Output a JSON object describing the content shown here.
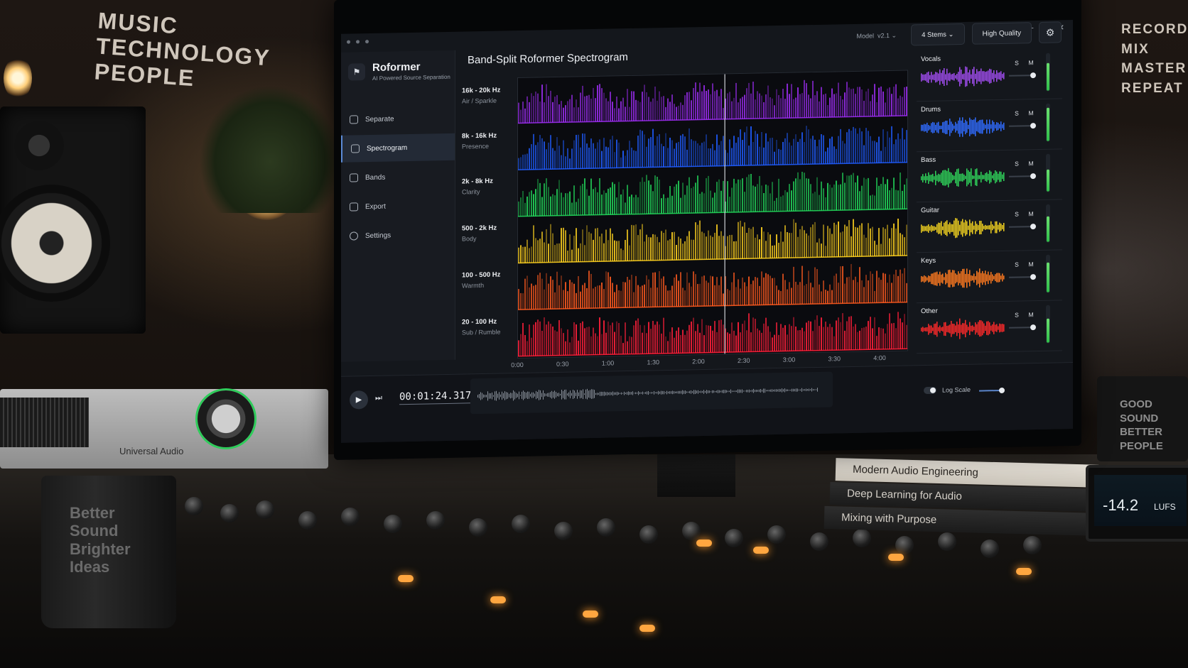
{
  "background": {
    "wall_sign_left": [
      "MUSIC",
      "TECHNOLOGY",
      "PEOPLE"
    ],
    "wall_sign_right": [
      "RECORD",
      "MIX",
      "MASTER",
      "REPEAT"
    ],
    "interface_brand": "Universal Audio",
    "mug_text": [
      "Better",
      "Sound",
      "Brighter",
      "Ideas"
    ],
    "cup_text": [
      "GOOD",
      "SOUND",
      "BETTER",
      "PEOPLE"
    ],
    "books": [
      "Modern Audio Engineering",
      "Deep Learning for Audio",
      "Mixing with Purpose"
    ],
    "loudness_meter": {
      "value": "-14.2",
      "unit": "LUFS"
    }
  },
  "app": {
    "title": "Roformer",
    "subtitle": "AI Powered Source Separation",
    "heading": "Band-Split Roformer Spectrogram",
    "window_controls": [
      "–",
      "▢",
      "✕"
    ],
    "toolbar": {
      "model_label": "Model",
      "model_version": "v2.1",
      "stems_label": "4 Stems",
      "quality_label": "High Quality",
      "gear_icon": "⚙"
    },
    "nav": [
      {
        "label": "Separate",
        "icon": "separate-icon"
      },
      {
        "label": "Spectrogram",
        "icon": "spectrogram-icon",
        "active": true
      },
      {
        "label": "Bands",
        "icon": "bands-icon"
      },
      {
        "label": "Export",
        "icon": "export-icon"
      },
      {
        "label": "Settings",
        "icon": "settings-icon"
      }
    ],
    "bands": [
      {
        "range": "16k - 20k Hz",
        "desc": "Air / Sparkle",
        "color": "#9b2cf0"
      },
      {
        "range": "8k - 16k Hz",
        "desc": "Presence",
        "color": "#1f5cff"
      },
      {
        "range": "2k - 8k Hz",
        "desc": "Clarity",
        "color": "#22d65a"
      },
      {
        "range": "500 - 2k Hz",
        "desc": "Body",
        "color": "#ffd21f"
      },
      {
        "range": "100 - 500 Hz",
        "desc": "Warmth",
        "color": "#ff5a1f"
      },
      {
        "range": "20 - 100 Hz",
        "desc": "Sub / Rumble",
        "color": "#ff1f3a"
      }
    ],
    "time_ticks": [
      "0:00",
      "0:30",
      "1:00",
      "1:30",
      "2:00",
      "2:30",
      "3:00",
      "3:30",
      "4:00"
    ],
    "stems": [
      {
        "name": "Vocals",
        "solo": "S",
        "mute": "M",
        "color": "#a14cf0",
        "level": 0.75
      },
      {
        "name": "Drums",
        "solo": "S",
        "mute": "M",
        "color": "#2f6bff",
        "level": 0.9
      },
      {
        "name": "Bass",
        "solo": "S",
        "mute": "M",
        "color": "#2fd35a",
        "level": 0.6
      },
      {
        "name": "Guitar",
        "solo": "S",
        "mute": "M",
        "color": "#f2d21f",
        "level": 0.7
      },
      {
        "name": "Keys",
        "solo": "S",
        "mute": "M",
        "color": "#ff7a1f",
        "level": 0.8
      },
      {
        "name": "Other",
        "solo": "S",
        "mute": "M",
        "color": "#ff2a2a",
        "level": 0.65
      }
    ],
    "transport": {
      "play_icon": "▶",
      "skip_icon": "⏭",
      "timecode": "00:01:24.317",
      "log_scale_label": "Log Scale"
    }
  }
}
